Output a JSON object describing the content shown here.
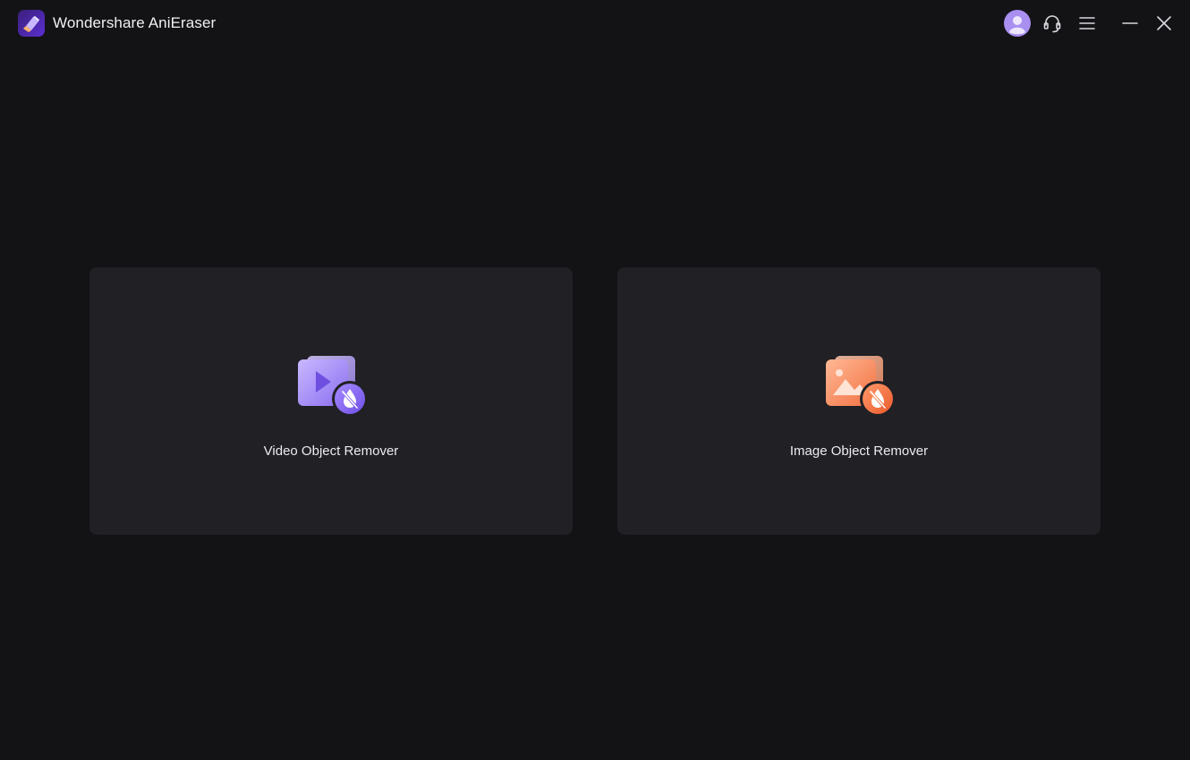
{
  "window": {
    "title": "Wondershare AniEraser",
    "icons": {
      "logo": "anieraser-logo-icon",
      "account": "user-avatar-icon",
      "support": "headset-icon",
      "menu": "hamburger-menu-icon",
      "minimize": "minimize-icon",
      "close": "close-icon"
    }
  },
  "cards": [
    {
      "label": "Video Object Remover",
      "icon": "video-object-remover-icon",
      "accent": "#8b6cf2"
    },
    {
      "label": "Image Object Remover",
      "icon": "image-object-remover-icon",
      "accent": "#f26a3e"
    }
  ],
  "colors": {
    "background": "#131316",
    "card": "#202025",
    "text": "#ececf0"
  }
}
